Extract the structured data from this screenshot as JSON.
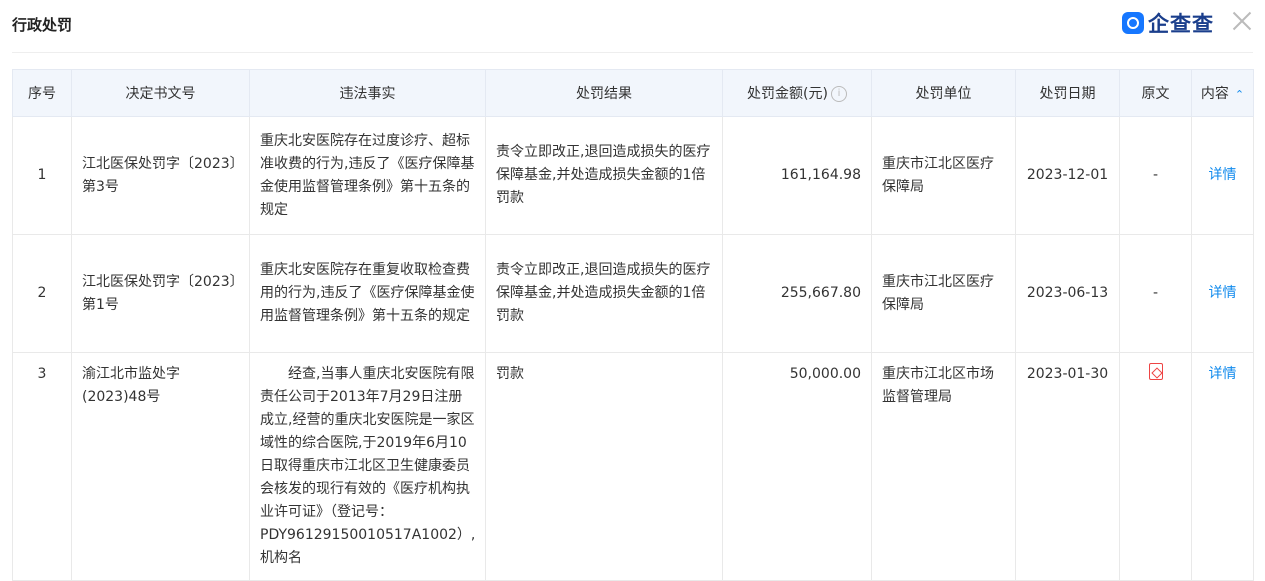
{
  "header": {
    "title": "行政处罚",
    "brand": "企查查"
  },
  "columns": {
    "index": "序号",
    "doc_no": "决定书文号",
    "facts": "违法事实",
    "result": "处罚结果",
    "amount": "处罚金额(元)",
    "authority": "处罚单位",
    "date": "处罚日期",
    "original": "原文",
    "content": "内容"
  },
  "rows": [
    {
      "index": "1",
      "doc_no": "江北医保处罚字〔2023〕第3号",
      "facts": "重庆北安医院存在过度诊疗、超标准收费的行为,违反了《医疗保障基金使用监督管理条例》第十五条的规定",
      "result": "责令立即改正,退回造成损失的医疗保障基金,并处造成损失金额的1倍罚款",
      "amount": "161,164.98",
      "authority": "重庆市江北区医疗保障局",
      "date": "2023-12-01",
      "original": "-",
      "detail": "详情"
    },
    {
      "index": "2",
      "doc_no": "江北医保处罚字〔2023〕第1号",
      "facts": "重庆北安医院存在重复收取检查费用的行为,违反了《医疗保障基金使用监督管理条例》第十五条的规定",
      "result": "责令立即改正,退回造成损失的医疗保障基金,并处造成损失金额的1倍罚款",
      "amount": "255,667.80",
      "authority": "重庆市江北区医疗保障局",
      "date": "2023-06-13",
      "original": "-",
      "detail": "详情"
    },
    {
      "index": "3",
      "doc_no": "渝江北市监处字(2023)48号",
      "facts": "经查,当事人重庆北安医院有限责任公司于2013年7月29日注册成立,经营的重庆北安医院是一家区域性的综合医院,于2019年6月10日取得重庆市江北区卫生健康委员会核发的现行有效的《医疗机构执业许可证》（登记号：PDY96129150010517A1002）,机构名",
      "result": "罚款",
      "amount": "50,000.00",
      "authority": "重庆市江北区市场监督管理局",
      "date": "2023-01-30",
      "original_icon": "pdf-icon",
      "detail": "详情"
    }
  ]
}
